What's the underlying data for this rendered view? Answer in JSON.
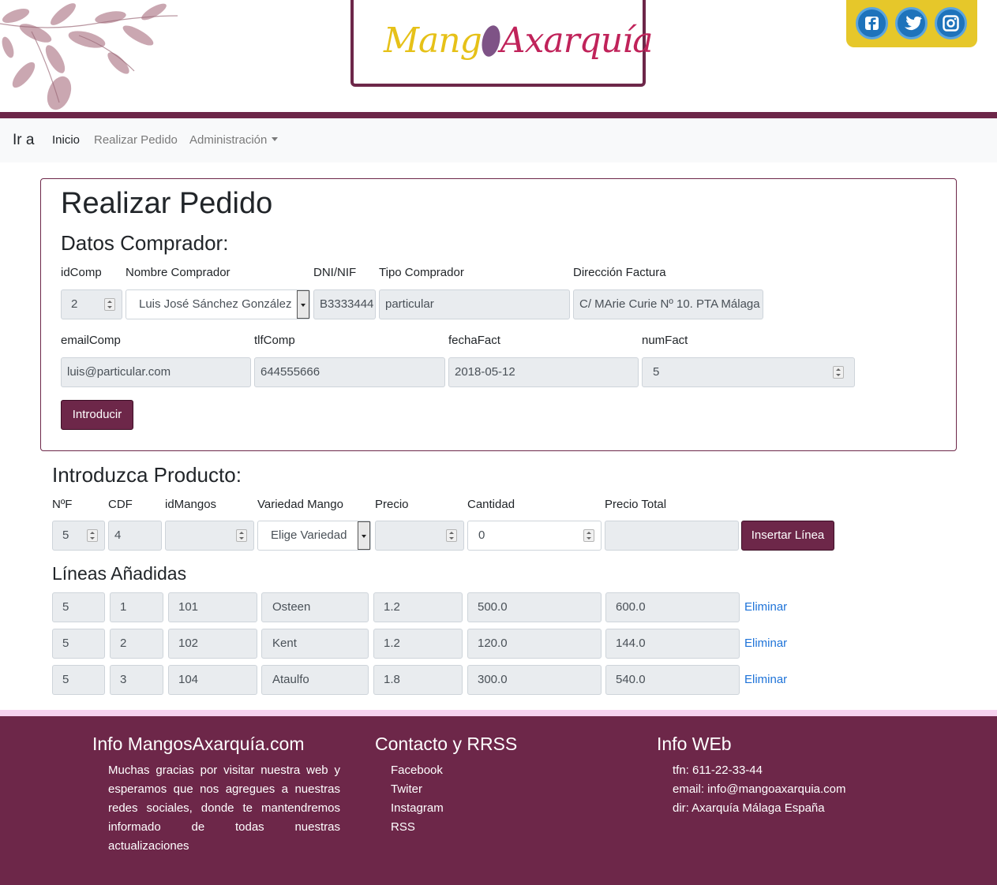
{
  "header": {
    "logo_left": "Mang",
    "logo_right": "Axarquía",
    "social": [
      "facebook-icon",
      "twitter-icon",
      "instagram-icon"
    ]
  },
  "nav": {
    "brand": "Ir a",
    "links": [
      "Inicio",
      "Realizar Pedido",
      "Administración"
    ]
  },
  "page_title": "Realizar Pedido",
  "comprador": {
    "section_title": "Datos Comprador:",
    "labels": {
      "idComp": "idComp",
      "nombre": "Nombre Comprador",
      "dni": "DNI/NIF",
      "tipo": "Tipo Comprador",
      "direccion": "Dirección Factura",
      "email": "emailComp",
      "tlf": "tlfComp",
      "fecha": "fechaFact",
      "numFact": "numFact"
    },
    "values": {
      "idComp": "2",
      "nombre": "Luis José Sánchez González",
      "dni": "B3333444",
      "tipo": "particular",
      "direccion": "C/ MArie Curie Nº 10. PTA Málaga",
      "email": "luis@particular.com",
      "tlf": "644555666",
      "fecha": "2018-05-12",
      "numFact": "5"
    },
    "submit_label": "Introducir"
  },
  "producto": {
    "section_title": "Introduzca Producto:",
    "labels": [
      "NºF",
      "CDF",
      "idMangos",
      "Variedad Mango",
      "Precio",
      "Cantidad",
      "Precio Total"
    ],
    "values": {
      "nf": "5",
      "cdf": "4",
      "idMangos": "",
      "variedad": "Elige Variedad",
      "precio": "",
      "cantidad": "0",
      "total": ""
    },
    "insert_label": "Insertar Línea"
  },
  "lineas": {
    "section_title": "Líneas Añadidas",
    "rows": [
      [
        "5",
        "1",
        "101",
        "Osteen",
        "1.2",
        "500.0",
        "600.0"
      ],
      [
        "5",
        "2",
        "102",
        "Kent",
        "1.2",
        "120.0",
        "144.0"
      ],
      [
        "5",
        "3",
        "104",
        "Ataulfo",
        "1.8",
        "300.0",
        "540.0"
      ]
    ],
    "delete_label": "Eliminar"
  },
  "footer": {
    "info_title": "Info MangosAxarquía.com",
    "info_text": "Muchas gracias por visitar nuestra web y esperamos que nos agregues a nuestras redes sociales, donde te mantendremos informado de todas nuestras actualizaciones",
    "contact_title": "Contacto y RRSS",
    "contact_links": [
      "Facebook",
      "Twiter",
      "Instagram",
      "RSS"
    ],
    "web_title": "Info WEb",
    "web_lines": [
      "tfn: 611-22-33-44",
      "email: info@mangoaxarquia.com",
      "dir: Axarquía Málaga España"
    ]
  },
  "colors": {
    "brand": "#6d2749",
    "social_bg": "#e6c72a",
    "link": "#1e73d8"
  }
}
